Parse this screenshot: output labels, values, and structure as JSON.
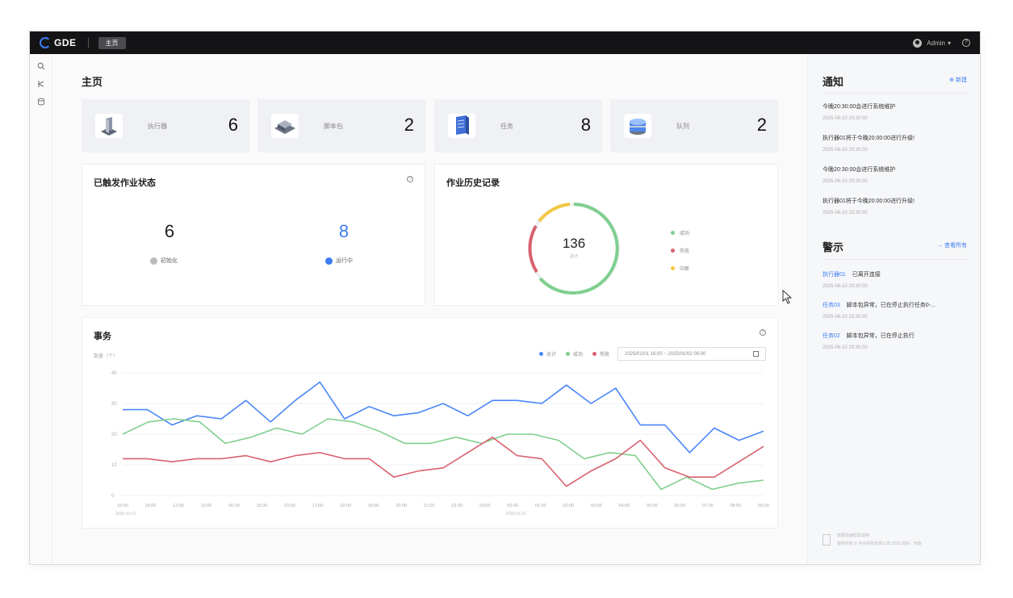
{
  "topbar": {
    "brand": "GDE",
    "home_tab": "主页",
    "user": "Admin",
    "user_caret": "▾",
    "help": "?"
  },
  "page": {
    "title": "主页"
  },
  "stats": [
    {
      "label": "执行器",
      "value": "6",
      "icon": "executor-icon"
    },
    {
      "label": "脚本包",
      "value": "2",
      "icon": "script-package-icon"
    },
    {
      "label": "任务",
      "value": "8",
      "icon": "task-icon"
    },
    {
      "label": "队列",
      "value": "2",
      "icon": "queue-icon"
    }
  ],
  "triggered": {
    "title": "已触发作业状态",
    "initializing": {
      "value": "6",
      "label": "初始化"
    },
    "running": {
      "value": "8",
      "label": "运行中",
      "color": "#3d7cf5"
    }
  },
  "history": {
    "title": "作业历史记录",
    "total": "136",
    "total_label": "总计",
    "legend": [
      {
        "label": "成功",
        "color": "#7fcf8f"
      },
      {
        "label": "失败",
        "color": "#d9626f"
      },
      {
        "label": "中断",
        "color": "#f2c744"
      }
    ]
  },
  "transactions": {
    "title": "事务",
    "date_range": "2025/01/01 16:00 ~ 2025/01/02 06:00",
    "chart_data": {
      "type": "line",
      "ylabel": "数量（个）",
      "ylim": [
        0,
        40
      ],
      "yticks": [
        "40",
        "30",
        "20",
        "10",
        "0"
      ],
      "x_date_labels": [
        "2025-01-01",
        "2025-01-02"
      ],
      "x": [
        "16:00",
        "18:00",
        "12:00",
        "10:00",
        "06:00",
        "15:00",
        "03:00",
        "17:00",
        "18:00",
        "16:00",
        "20:00",
        "21:00",
        "22:00",
        "23:00",
        "00:00",
        "01:00",
        "02:00",
        "03:00",
        "04:00",
        "05:00",
        "06:00",
        "07:00",
        "08:00",
        "09:00"
      ],
      "series": [
        {
          "name": "总计",
          "color": "#4a86f7",
          "values": [
            28,
            28,
            23,
            26,
            25,
            31,
            24,
            31,
            37,
            25,
            29,
            26,
            27,
            30,
            26,
            31,
            31,
            30,
            36,
            30,
            35,
            23,
            23,
            14,
            22,
            18,
            21
          ]
        },
        {
          "name": "成功",
          "color": "#7fcf8f",
          "values": [
            20,
            24,
            25,
            24,
            17,
            19,
            22,
            20,
            25,
            24,
            21,
            17,
            17,
            19,
            17,
            20,
            20,
            18,
            12,
            14,
            13,
            2,
            6,
            2,
            4,
            5
          ]
        },
        {
          "name": "失败",
          "color": "#d9626f",
          "values": [
            12,
            12,
            11,
            12,
            12,
            13,
            11,
            13,
            14,
            12,
            12,
            6,
            8,
            9,
            14,
            19,
            13,
            12,
            3,
            8,
            12,
            18,
            9,
            6,
            6,
            11,
            16
          ]
        }
      ]
    }
  },
  "notices": {
    "title": "通知",
    "action": "新建",
    "items": [
      {
        "text": "今晚20:30:00会进行系统维护",
        "time": "2025-06-10 20:30:00"
      },
      {
        "text": "执行器01将于今晚20:00:00进行升级!",
        "time": "2025-06-10 20:30:00"
      },
      {
        "text": "今晚20:30:00会进行系统维护",
        "time": "2025-06-10 20:30:00"
      },
      {
        "text": "执行器01将于今晚20:00:00进行升级!",
        "time": "2025-06-10 20:30:00"
      }
    ]
  },
  "warnings": {
    "title": "警示",
    "action": "查看所有",
    "items": [
      {
        "link": "执行器01",
        "text": "已离开连接",
        "time": "2025-06-10 20:30:00"
      },
      {
        "link": "任务03",
        "text": "脚本包异常，已在停止执行任务0-...",
        "time": "2025-06-10 20:30:00"
      },
      {
        "link": "任务02",
        "text": "脚本包异常，已在停止执行",
        "time": "2025-06-10 20:30:00"
      }
    ]
  },
  "footer": {
    "line1": "数据连接帮助说明",
    "line2": "版权所有 © 平台科技有限公司 2025 隐私 · 条款"
  }
}
